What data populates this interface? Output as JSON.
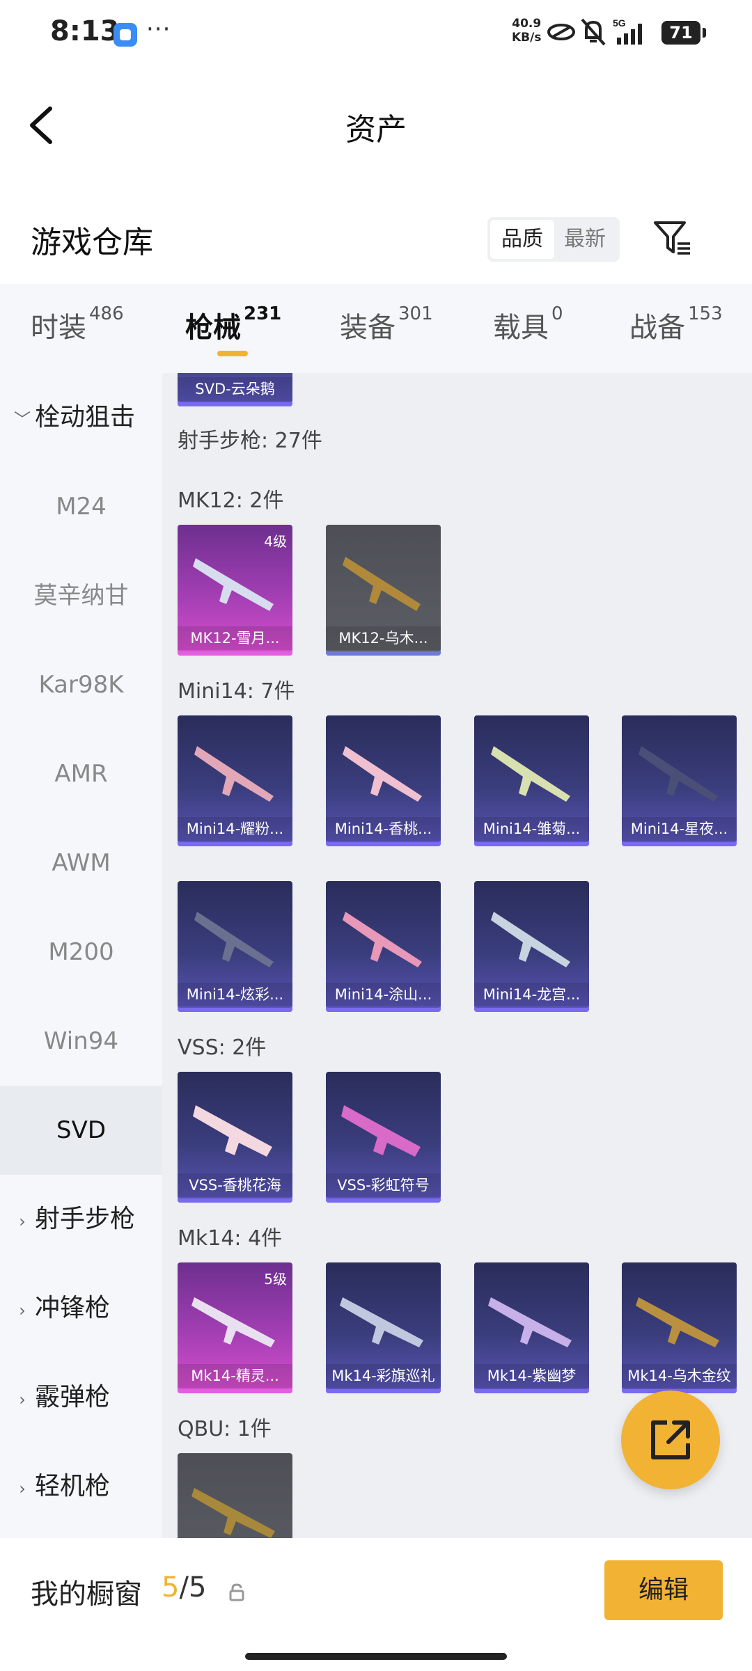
{
  "status_bar": {
    "time": "8:13",
    "dots": "···",
    "speed_value": "40.9",
    "speed_unit": "KB/s",
    "battery": "71"
  },
  "header": {
    "title": "资产"
  },
  "section": {
    "title": "游戏仓库",
    "sort_quality": "品质",
    "sort_newest": "最新"
  },
  "tabs": [
    {
      "label": "时装",
      "count": "486"
    },
    {
      "label": "枪械",
      "count": "231"
    },
    {
      "label": "装备",
      "count": "301"
    },
    {
      "label": "载具",
      "count": "0"
    },
    {
      "label": "战备",
      "count": "153"
    }
  ],
  "sidebar": {
    "group_sniper": "栓动狙击",
    "items": [
      "M24",
      "莫辛纳甘",
      "Kar98K",
      "AMR",
      "AWM",
      "M200",
      "Win94",
      "SVD"
    ],
    "groups": [
      "射手步枪",
      "冲锋枪",
      "霰弹枪",
      "轻机枪"
    ]
  },
  "content": {
    "top_card": "SVD-云朵鹅",
    "dmr_header": "射手步枪: 27件",
    "mk12_header": "MK12: 2件",
    "mk12": [
      {
        "name": "MK12-雪月...",
        "level": "4级"
      },
      {
        "name": "MK12-乌木..."
      }
    ],
    "mini14_header": "Mini14: 7件",
    "mini14": [
      "Mini14-耀粉...",
      "Mini14-香桃...",
      "Mini14-雏菊...",
      "Mini14-星夜...",
      "Mini14-炫彩...",
      "Mini14-涂山...",
      "Mini14-龙宫..."
    ],
    "vss_header": "VSS: 2件",
    "vss": [
      "VSS-香桃花海",
      "VSS-彩虹符号"
    ],
    "mk14_header": "Mk14: 4件",
    "mk14": [
      {
        "name": "Mk14-精灵...",
        "level": "5级"
      },
      {
        "name": "Mk14-彩旗巡礼"
      },
      {
        "name": "Mk14-紫幽梦"
      },
      {
        "name": "Mk14-乌木金纹"
      }
    ],
    "qbu_header": "QBU: 1件"
  },
  "footer": {
    "label": "我的橱窗",
    "count_current": "5",
    "count_sep": "/",
    "count_max": "5",
    "edit_label": "编辑"
  },
  "colors": {
    "accent": "#f2b233",
    "card_purple": "#3a3d7c",
    "card_pink": "#a43fb4",
    "card_grey": "#5d5f66"
  }
}
